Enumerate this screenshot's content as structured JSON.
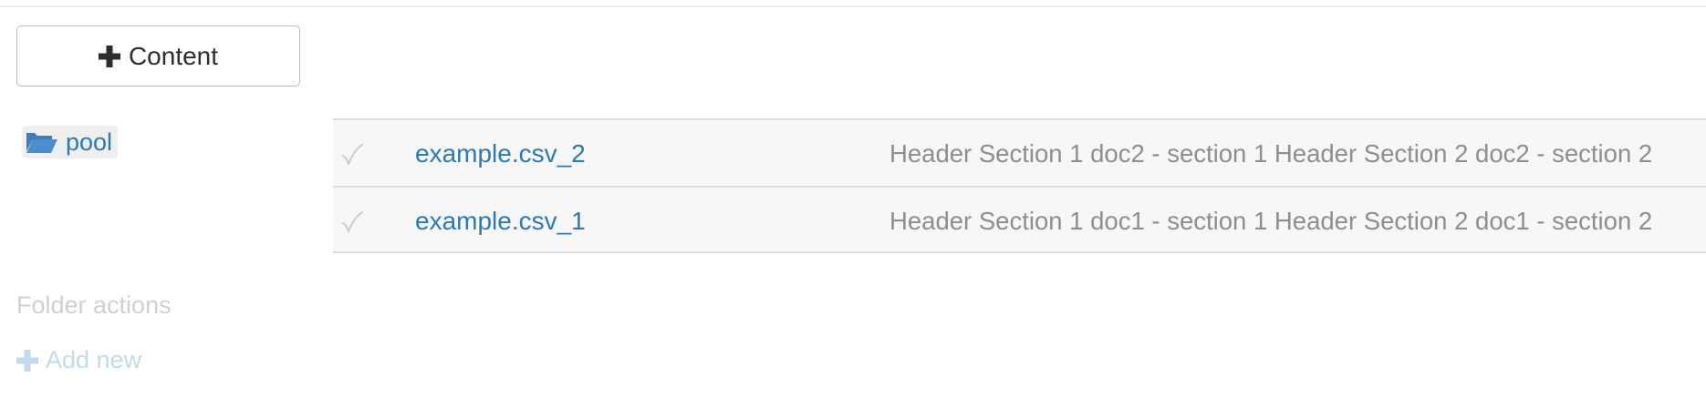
{
  "toolbar": {
    "add_content_label": "Content",
    "add_content_icon": "plus-icon"
  },
  "folder": {
    "name": "pool",
    "icon": "folder-open-icon"
  },
  "files": [
    {
      "name": "example.csv_2",
      "summary": "Header Section 1 doc2 - section 1 Header Section 2 doc2 - section 2",
      "icon": "checkmark-icon"
    },
    {
      "name": "example.csv_1",
      "summary": "Header Section 1 doc1 - section 1 Header Section 2 doc1 - section 2",
      "icon": "checkmark-icon"
    }
  ],
  "folder_actions": {
    "heading": "Folder actions",
    "add_new_label": "Add new",
    "add_new_icon": "plus-icon"
  },
  "colors": {
    "link": "#2b79b8",
    "muted_text": "#8e8e8e",
    "disabled_text": "#d0d0d0",
    "disabled_link": "#c3d9ec",
    "row_background": "#f7f7f7"
  }
}
